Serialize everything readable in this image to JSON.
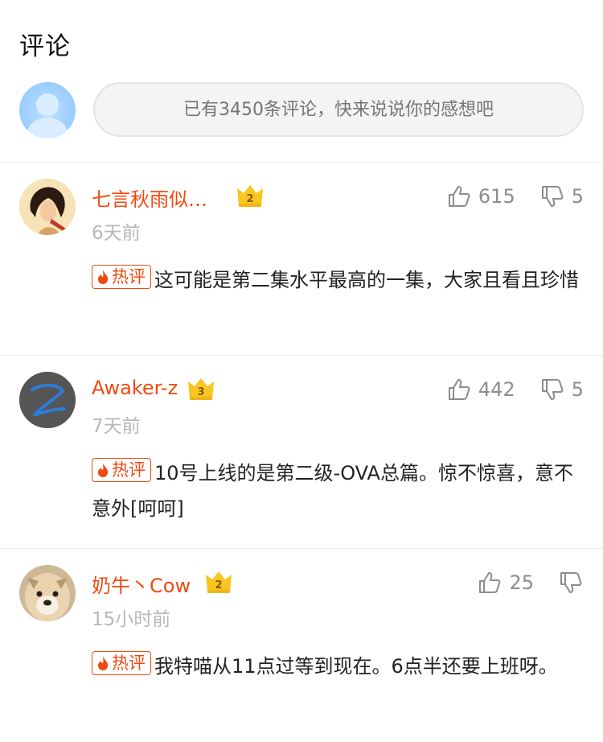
{
  "header": {
    "title": "评论"
  },
  "composer": {
    "placeholder": "已有3450条评论，快来说说你的感想吧"
  },
  "colors": {
    "accent": "#f04a10",
    "muted": "#b8b8b8",
    "badge_gold": "#f7c623"
  },
  "comments": [
    {
      "username": "七言秋雨似…",
      "badge_level": "2",
      "time": "6天前",
      "likes": "615",
      "replies": "5",
      "tag": "热评",
      "text": "这可能是第二集水平最高的一集，大家且看且珍惜"
    },
    {
      "username": "Awaker-z",
      "badge_level": "3",
      "time": "7天前",
      "likes": "442",
      "replies": "5",
      "tag": "热评",
      "text": "10号上线的是第二级-OVA总篇。惊不惊喜，意不意外[呵呵]"
    },
    {
      "username": "奶牛丶Cow",
      "badge_level": "2",
      "time": "15小时前",
      "likes": "25",
      "replies": "",
      "tag": "热评",
      "text": "我特喵从11点过等到现在。6点半还要上班呀。"
    }
  ]
}
